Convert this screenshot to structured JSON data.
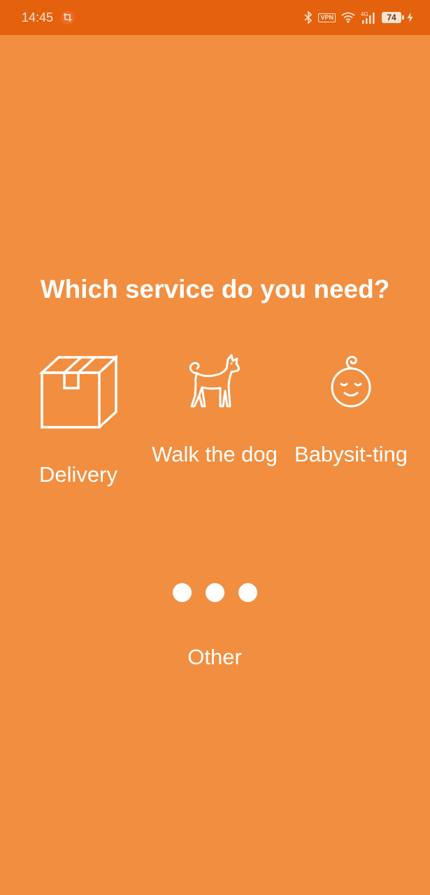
{
  "status_bar": {
    "time": "14:45",
    "vpn": "VPN",
    "network": "4G",
    "battery": "74",
    "icons": [
      "notification-crop-icon",
      "bluetooth-icon",
      "vpn-icon",
      "wifi-icon",
      "signal-icon",
      "battery-icon",
      "charging-icon"
    ]
  },
  "screen": {
    "title": "Which service do you need?",
    "options": [
      {
        "id": "delivery",
        "label": "Delivery",
        "icon": "box-icon"
      },
      {
        "id": "dog",
        "label": "Walk the dog",
        "icon": "dog-icon"
      },
      {
        "id": "babysitting",
        "label": "Babysit-ting",
        "icon": "baby-face-icon"
      },
      {
        "id": "other",
        "label": "Other",
        "icon": "three-dots-icon"
      }
    ]
  },
  "colors": {
    "background": "#F28E3F",
    "status_bar": "#E4620E",
    "foreground": "#FFFFFF"
  }
}
